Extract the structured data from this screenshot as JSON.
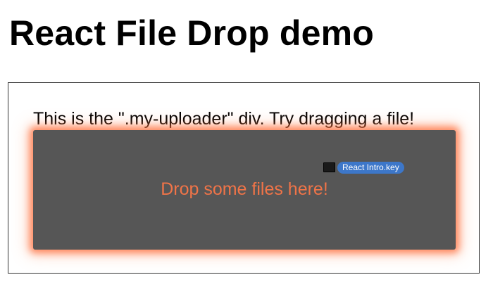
{
  "page": {
    "title": "React File Drop demo"
  },
  "uploader": {
    "caption": "This is the \".my-uploader\" div. Try dragging a file!",
    "drop_message": "Drop some files here!",
    "dragged_file": {
      "name": "React Intro.key",
      "icon": "keynote-file-icon"
    }
  },
  "colors": {
    "drop_zone_bg": "#565656",
    "drop_message": "#f07448",
    "glow": "#ff6e3c",
    "file_label_bg": "#3d77c9"
  }
}
